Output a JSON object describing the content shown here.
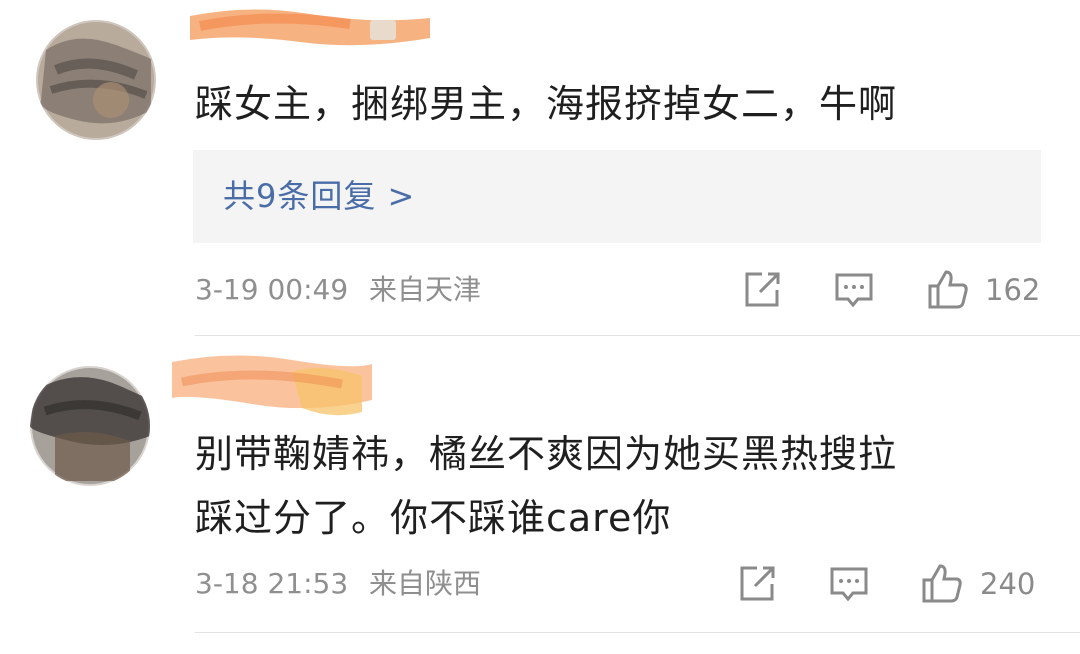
{
  "comments": [
    {
      "text_lines": [
        "踩女主，捆绑男主，海报挤掉女二，牛啊"
      ],
      "replies_label": "共9条回复 >",
      "date": "3-19 00:49",
      "location": "来自天津",
      "likes": "162"
    },
    {
      "text_lines": [
        "别带鞠婧祎，橘丝不爽因为她买黑热搜拉",
        "踩过分了。你不踩谁care你"
      ],
      "date": "3-18 21:53",
      "location": "来自陕西",
      "likes": "240"
    }
  ],
  "icons": {
    "share": "share-icon",
    "comment": "comment-icon",
    "like": "thumbs-up-icon"
  },
  "colors": {
    "link": "#4a6da8",
    "meta": "#8f8f8f",
    "reply_bg": "#f4f4f4"
  }
}
